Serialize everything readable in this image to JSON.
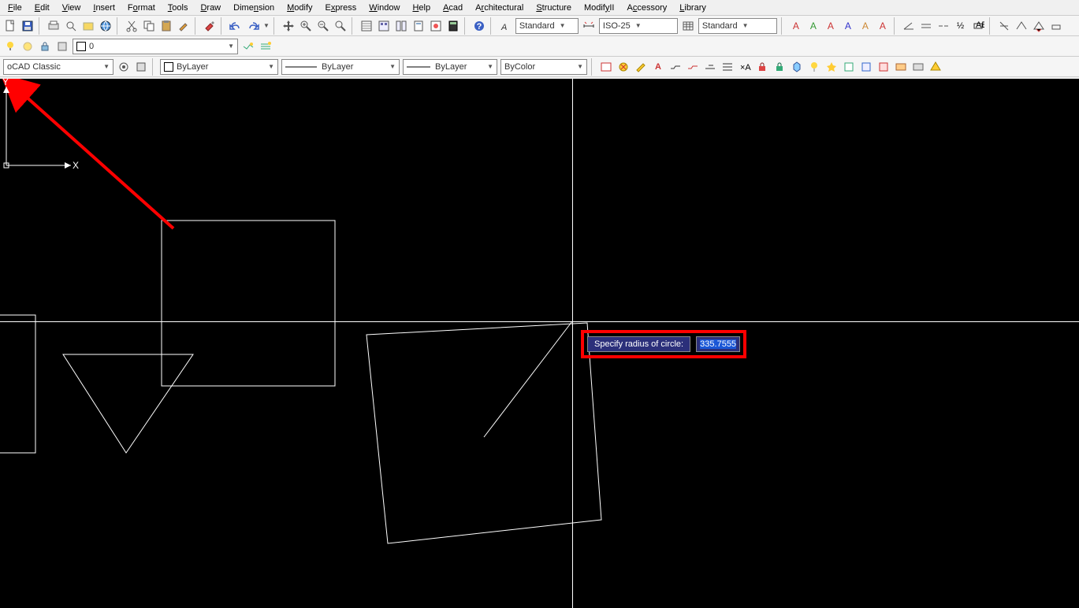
{
  "menu": [
    "File",
    "Edit",
    "View",
    "Insert",
    "Format",
    "Tools",
    "Draw",
    "Dimension",
    "Modify",
    "Express",
    "Window",
    "Help",
    "Acad",
    "Architectural",
    "Structure",
    "ModifyII",
    "Accessory",
    "Library"
  ],
  "toolbar2_layer_value": "0",
  "toolbar3": {
    "workspace": "oCAD Classic",
    "bylayer1": "ByLayer",
    "bylayer2": "ByLayer",
    "bylayer3": "ByLayer",
    "bycolor": "ByColor"
  },
  "toolbar1": {
    "textstyle": "Standard",
    "dimstyle": "ISO-25",
    "tablestyle": "Standard"
  },
  "dyn_input": {
    "prompt": "Specify radius of circle:",
    "value": "335.7555"
  },
  "ucs": {
    "x": "X",
    "y": "Y"
  }
}
